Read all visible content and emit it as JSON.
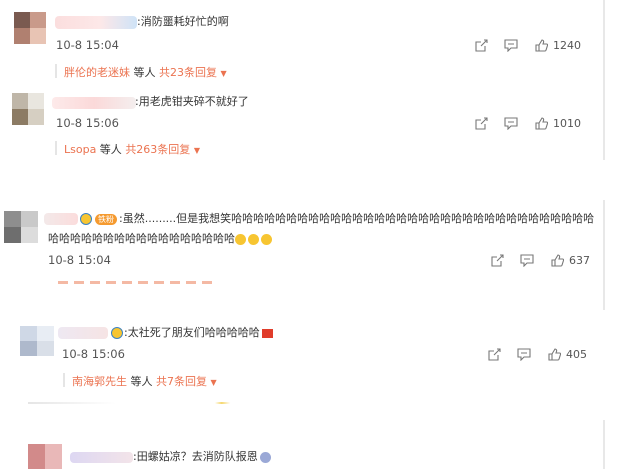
{
  "comments": [
    {
      "text": ":消防噩耗好忙的啊",
      "time": "10-8 15:04",
      "likes": "1240",
      "reply": {
        "names": "胖伦的老迷妹",
        "middle": " 等人 ",
        "total": "共23条回复",
        "arrow": "▼"
      }
    },
    {
      "text": ":用老虎钳夹碎不就好了",
      "time": "10-8 15:06",
      "likes": "1010",
      "reply": {
        "names": "Lsopa",
        "middle": " 等人 ",
        "total": "共263条回复",
        "arrow": "▼"
      }
    },
    {
      "badge": "铁粉",
      "text_line1": ":虽然.........但是我想笑哈哈哈哈哈哈哈哈哈哈哈哈哈哈哈哈哈哈哈哈哈哈哈哈哈哈哈哈哈哈哈哈哈",
      "text_line2": "哈哈哈哈哈哈哈哈哈哈哈哈哈哈哈哈哈",
      "time": "10-8 15:04",
      "likes": "637"
    },
    {
      "text": ":太社死了朋友们哈哈哈哈哈",
      "time": "10-8 15:06",
      "likes": "405",
      "reply": {
        "names": "南海郭先生",
        "middle": " 等人 ",
        "total": "共7条回复",
        "arrow": "▼"
      }
    },
    {
      "text": ":田螺姑凉？去消防队报恩"
    }
  ],
  "icons": {
    "share": "share-icon",
    "comment": "comment-icon",
    "like": "thumbs-up-icon"
  }
}
